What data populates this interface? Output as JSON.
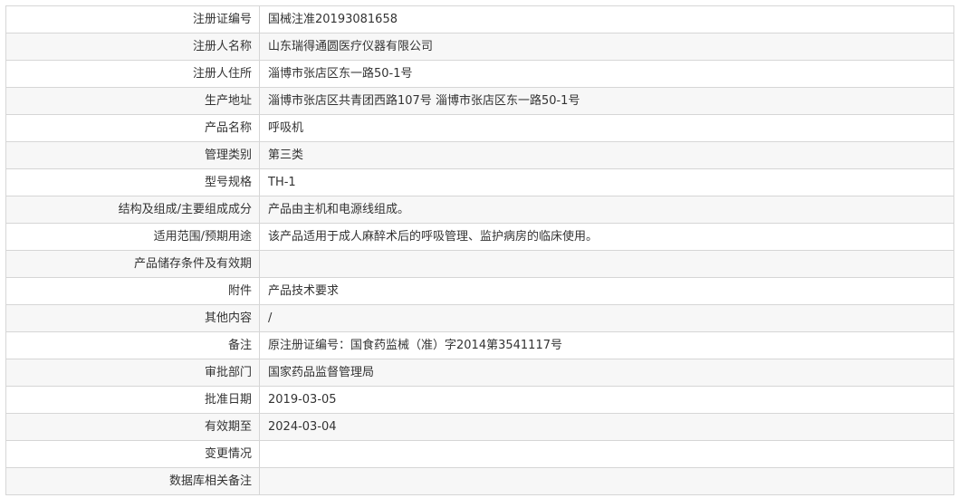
{
  "rows": [
    {
      "label": "注册证编号",
      "value": "国械注准20193081658"
    },
    {
      "label": "注册人名称",
      "value": "山东瑞得通圆医疗仪器有限公司"
    },
    {
      "label": "注册人住所",
      "value": "淄博市张店区东一路50-1号"
    },
    {
      "label": "生产地址",
      "value": "淄博市张店区共青团西路107号 淄博市张店区东一路50-1号"
    },
    {
      "label": "产品名称",
      "value": "呼吸机"
    },
    {
      "label": "管理类别",
      "value": "第三类"
    },
    {
      "label": "型号规格",
      "value": "TH-1"
    },
    {
      "label": "结构及组成/主要组成成分",
      "value": "产品由主机和电源线组成。"
    },
    {
      "label": "适用范围/预期用途",
      "value": "该产品适用于成人麻醉术后的呼吸管理、监护病房的临床使用。"
    },
    {
      "label": "产品储存条件及有效期",
      "value": ""
    },
    {
      "label": "附件",
      "value": "产品技术要求"
    },
    {
      "label": "其他内容",
      "value": "/"
    },
    {
      "label": "备注",
      "value": "原注册证编号：国食药监械（准）字2014第3541117号"
    },
    {
      "label": "审批部门",
      "value": "国家药品监督管理局"
    },
    {
      "label": "批准日期",
      "value": "2019-03-05"
    },
    {
      "label": "有效期至",
      "value": "2024-03-04"
    },
    {
      "label": "变更情况",
      "value": ""
    },
    {
      "label": "数据库相关备注",
      "value": ""
    }
  ]
}
